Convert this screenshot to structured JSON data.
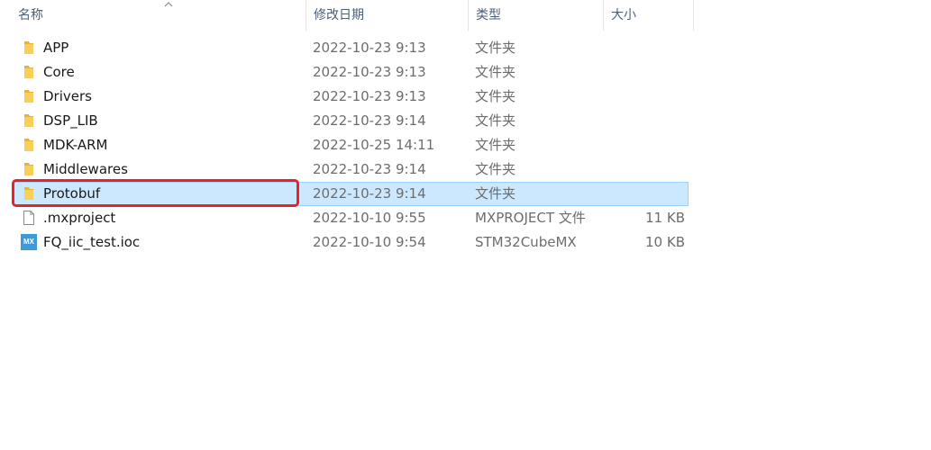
{
  "header": {
    "name": "名称",
    "date_modified": "修改日期",
    "type": "类型",
    "size": "大小"
  },
  "colors": {
    "selection_bg": "#cce8ff",
    "selection_border": "#99d1ff",
    "highlight": "#e8222a",
    "folder": "#f5c542"
  },
  "files": [
    {
      "name": "APP",
      "date": "2022-10-23 9:13",
      "type": "文件夹",
      "size": "",
      "icon": "folder-icon"
    },
    {
      "name": "Core",
      "date": "2022-10-23 9:13",
      "type": "文件夹",
      "size": "",
      "icon": "folder-icon"
    },
    {
      "name": "Drivers",
      "date": "2022-10-23 9:13",
      "type": "文件夹",
      "size": "",
      "icon": "folder-icon"
    },
    {
      "name": "DSP_LIB",
      "date": "2022-10-23 9:14",
      "type": "文件夹",
      "size": "",
      "icon": "folder-icon"
    },
    {
      "name": "MDK-ARM",
      "date": "2022-10-25 14:11",
      "type": "文件夹",
      "size": "",
      "icon": "folder-icon"
    },
    {
      "name": "Middlewares",
      "date": "2022-10-23 9:14",
      "type": "文件夹",
      "size": "",
      "icon": "folder-icon"
    },
    {
      "name": "Protobuf",
      "date": "2022-10-23 9:14",
      "type": "文件夹",
      "size": "",
      "icon": "folder-icon",
      "selected": true
    },
    {
      "name": ".mxproject",
      "date": "2022-10-10 9:55",
      "type": "MXPROJECT 文件",
      "size": "11 KB",
      "icon": "file-icon"
    },
    {
      "name": "FQ_iic_test.ioc",
      "date": "2022-10-10 9:54",
      "type": "STM32CubeMX",
      "size": "10 KB",
      "icon": "stm32cubemx-icon",
      "badge": "MX"
    }
  ]
}
